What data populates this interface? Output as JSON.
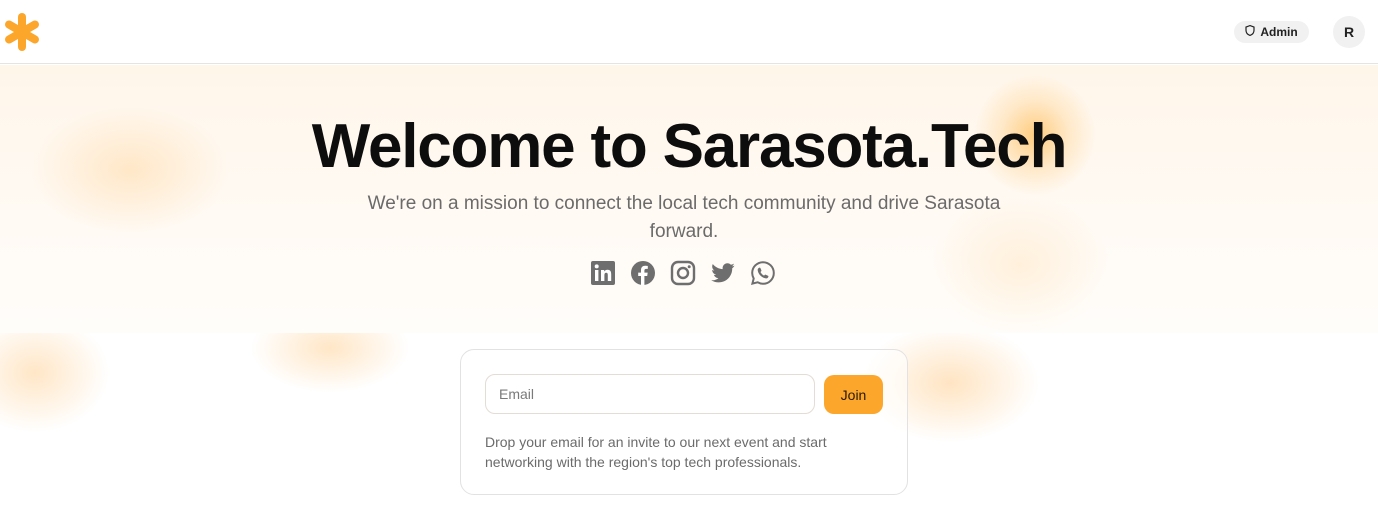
{
  "header": {
    "logo_icon": "orange-asterisk-logo",
    "admin_label": "Admin",
    "admin_icon": "shield-icon",
    "avatar_initial": "R"
  },
  "hero": {
    "title": "Welcome to Sarasota.Tech",
    "subtitle": "We're on a mission to connect the local tech community and drive Sarasota forward.",
    "socials": [
      {
        "icon": "linkedin-icon"
      },
      {
        "icon": "facebook-icon"
      },
      {
        "icon": "instagram-icon"
      },
      {
        "icon": "twitter-icon"
      },
      {
        "icon": "whatsapp-icon"
      }
    ]
  },
  "signup": {
    "email_placeholder": "Email",
    "email_value": "",
    "join_label": "Join",
    "note": "Drop your email for an invite to our next event and start networking with the region's top tech professionals."
  },
  "colors": {
    "accent": "#fca62b",
    "social_icon": "#6e6e6e",
    "title": "#0d0d0d"
  }
}
